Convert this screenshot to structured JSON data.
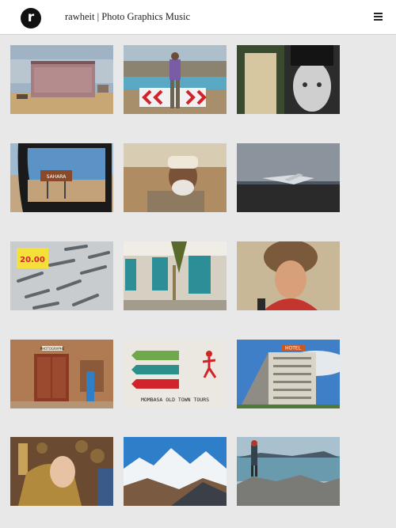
{
  "header": {
    "logo_letter": "r",
    "site_title": "rawheit | Photo Graphics Music",
    "menu_icon": "hamburger-menu-icon"
  },
  "gallery": {
    "photos": [
      {
        "subject": "kiosk-by-road",
        "sign_text": ""
      },
      {
        "subject": "hiker-at-chevron-barrier",
        "sign_text": ""
      },
      {
        "subject": "girl-painted-face",
        "sign_text": ""
      },
      {
        "subject": "car-mirror-desert-sign",
        "sign_text": "SAHARA"
      },
      {
        "subject": "bearded-man-kufi",
        "sign_text": ""
      },
      {
        "subject": "plane-wreck-black-sand",
        "sign_text": ""
      },
      {
        "subject": "fish-market-price",
        "sign_text": "20.00"
      },
      {
        "subject": "windows-and-palm",
        "sign_text": ""
      },
      {
        "subject": "smiling-woman-fur-hat",
        "sign_text": ""
      },
      {
        "subject": "wooden-doors-blue-robe",
        "sign_text": "PHOTOGRAPHE"
      },
      {
        "subject": "mombasa-street-sign",
        "sign_text": "MOMBASA OLD TOWN TOURS"
      },
      {
        "subject": "hotel-building-blue-sky",
        "sign_text": "HOTEL"
      },
      {
        "subject": "mao-statue-market",
        "sign_text": ""
      },
      {
        "subject": "snowy-mountains",
        "sign_text": ""
      },
      {
        "subject": "man-on-rocks-by-lake",
        "sign_text": ""
      }
    ]
  }
}
